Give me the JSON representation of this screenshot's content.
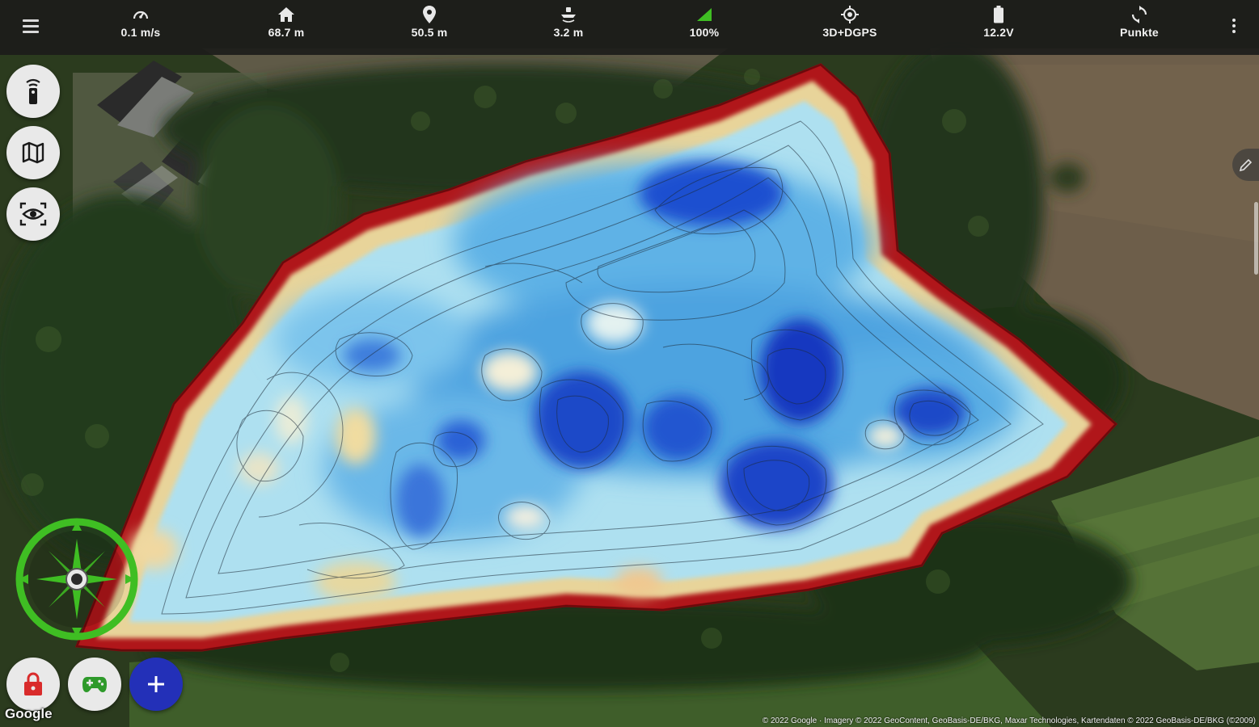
{
  "status_bar": {
    "speed": "0.1 m/s",
    "home_distance": "68.7 m",
    "point_distance": "50.5 m",
    "depth": "3.2 m",
    "signal": "100%",
    "gps_fix": "3D+DGPS",
    "voltage": "12.2V",
    "mode_label": "Punkte"
  },
  "icons": {
    "menu": "hamburger-icon",
    "speed": "speedometer-icon",
    "home": "home-icon",
    "point": "location-pin-icon",
    "depth": "sonar-depth-icon",
    "signal": "signal-strength-icon",
    "gps": "gps-target-icon",
    "battery": "battery-icon",
    "mode": "refresh-icon",
    "more": "more-vert-icon",
    "remote": "remote-control-icon",
    "map": "map-icon",
    "camera": "camera-view-icon",
    "lock": "lock-icon",
    "gamepad": "gamepad-icon",
    "add": "plus-icon",
    "compass": "compass-icon",
    "edit": "pencil-icon"
  },
  "colors": {
    "accent_green": "#3fbe23",
    "lock_red": "#d92b2b",
    "add_blue": "#2330b8",
    "bar_bg": "#1c1c1a"
  },
  "map": {
    "google_logo": "Google",
    "attribution": "© 2022 Google · Imagery © 2022 GeoContent, GeoBasis-DE/BKG, Maxar Technologies, Kartendaten © 2022 GeoBasis-DE/BKG (©2009)"
  }
}
